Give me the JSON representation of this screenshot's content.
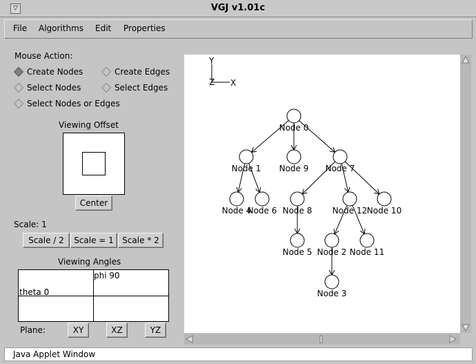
{
  "window": {
    "title": "VGJ v1.01c",
    "collapse_glyph": "▽",
    "status": "Java Applet Window"
  },
  "menu": [
    "File",
    "Algorithms",
    "Edit",
    "Properties"
  ],
  "controls": {
    "mouse_action_label": "Mouse Action:",
    "options": {
      "create_nodes": "Create Nodes",
      "create_edges": "Create Edges",
      "select_nodes": "Select Nodes",
      "select_edges": "Select Edges",
      "select_nodes_or_edges": "Select Nodes or Edges"
    },
    "selected_option": "create_nodes",
    "viewing_offset_label": "Viewing Offset",
    "center_button": "Center",
    "scale_label": "Scale: 1",
    "scale_half": "Scale / 2",
    "scale_one": "Scale = 1",
    "scale_double": "Scale * 2",
    "viewing_angles_label": "Viewing Angles",
    "phi_label": "phi 90",
    "theta_label": "theta 0",
    "plane_label": "Plane:",
    "plane_xy": "XY",
    "plane_xz": "XZ",
    "plane_yz": "YZ"
  },
  "axes": {
    "y": "Y",
    "z": "Z",
    "x": "X"
  },
  "graph": {
    "nodes": [
      "Node 0",
      "Node 1",
      "Node 9",
      "Node 7",
      "Node 4",
      "Node 6",
      "Node 8",
      "Node 12",
      "Node 10",
      "Node 5",
      "Node 2",
      "Node 11",
      "Node 3"
    ],
    "edges": [
      [
        "Node 0",
        "Node 1"
      ],
      [
        "Node 0",
        "Node 9"
      ],
      [
        "Node 0",
        "Node 7"
      ],
      [
        "Node 1",
        "Node 4"
      ],
      [
        "Node 1",
        "Node 6"
      ],
      [
        "Node 7",
        "Node 8"
      ],
      [
        "Node 7",
        "Node 12"
      ],
      [
        "Node 7",
        "Node 10"
      ],
      [
        "Node 8",
        "Node 5"
      ],
      [
        "Node 12",
        "Node 2"
      ],
      [
        "Node 12",
        "Node 11"
      ],
      [
        "Node 2",
        "Node 3"
      ]
    ]
  }
}
